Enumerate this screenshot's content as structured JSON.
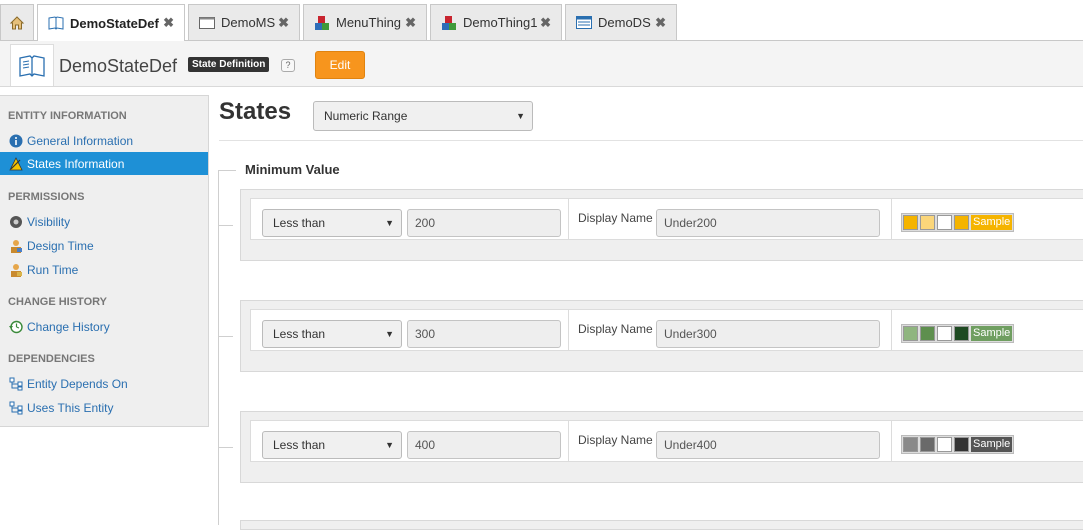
{
  "tabs": [
    {
      "label": "DemoStateDef",
      "icon": "book-icon",
      "active": true
    },
    {
      "label": "DemoMS",
      "icon": "window-icon",
      "active": false
    },
    {
      "label": "MenuThing",
      "icon": "thing-icon",
      "active": false
    },
    {
      "label": "DemoThing1",
      "icon": "thing-icon",
      "active": false
    },
    {
      "label": "DemoDS",
      "icon": "datashape-icon",
      "active": false
    }
  ],
  "tab_close_glyph": "✖",
  "header": {
    "entity_name": "DemoStateDef",
    "entity_type": "State Definition",
    "help": "?",
    "edit_label": "Edit"
  },
  "sidebar": {
    "sections": [
      {
        "heading": "ENTITY INFORMATION",
        "items": [
          {
            "label": "General Information",
            "icon": "info-icon",
            "active": false
          },
          {
            "label": "States Information",
            "icon": "states-icon",
            "active": true
          }
        ]
      },
      {
        "heading": "PERMISSIONS",
        "items": [
          {
            "label": "Visibility",
            "icon": "visibility-icon",
            "active": false
          },
          {
            "label": "Design Time",
            "icon": "design-time-icon",
            "active": false
          },
          {
            "label": "Run Time",
            "icon": "run-time-icon",
            "active": false
          }
        ]
      },
      {
        "heading": "CHANGE HISTORY",
        "items": [
          {
            "label": "Change History",
            "icon": "history-icon",
            "active": false
          }
        ]
      },
      {
        "heading": "DEPENDENCIES",
        "items": [
          {
            "label": "Entity Depends On",
            "icon": "dependency-icon",
            "active": false
          },
          {
            "label": "Uses This Entity",
            "icon": "dependency-icon",
            "active": false
          }
        ]
      }
    ]
  },
  "main": {
    "title": "States",
    "state_type": "Numeric Range",
    "section_title": "Minimum Value",
    "display_name_label": "Display Name",
    "sample_label": "Sample",
    "states": [
      {
        "comparison": "Less than",
        "value": "200",
        "display_name": "Under200",
        "colors": [
          "#f5b400",
          "#fbd67a",
          "#ffffff",
          "#f5b400"
        ],
        "sample_bg": "#f5b400",
        "sample_fg": "#ffffff"
      },
      {
        "comparison": "Less than",
        "value": "300",
        "display_name": "Under300",
        "colors": [
          "#8fb57f",
          "#5e8f4e",
          "#ffffff",
          "#1e4a22"
        ],
        "sample_bg": "#6f9e60",
        "sample_fg": "#ffffff"
      },
      {
        "comparison": "Less than",
        "value": "400",
        "display_name": "Under400",
        "colors": [
          "#8a8a8a",
          "#6a6a6a",
          "#ffffff",
          "#333333"
        ],
        "sample_bg": "#555555",
        "sample_fg": "#ffffff"
      }
    ]
  },
  "colors": {
    "accent": "#1e90d6",
    "edit_button": "#f7951d",
    "link": "#2a6fb0"
  }
}
